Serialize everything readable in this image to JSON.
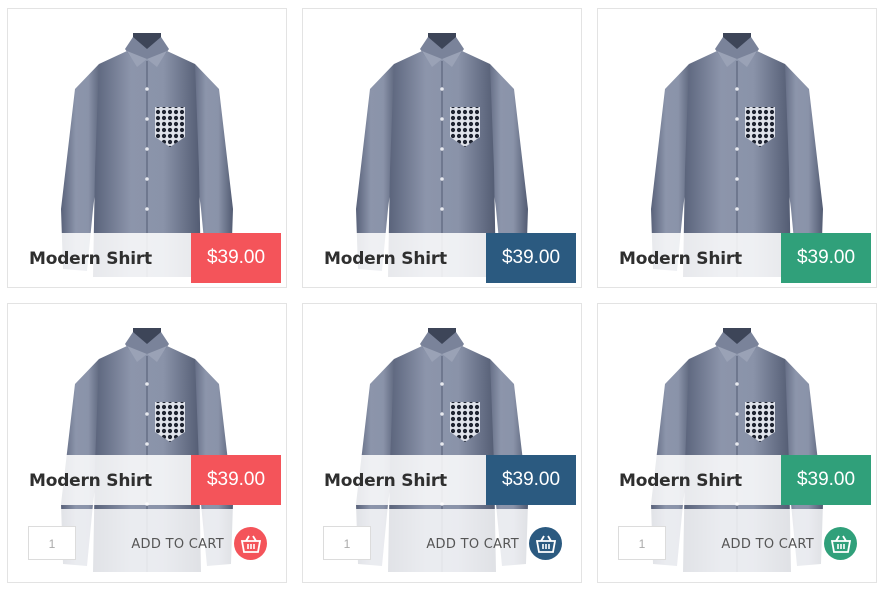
{
  "products": [
    {
      "name": "Modern Shirt",
      "price": "$39.00",
      "color": "#f4545a"
    },
    {
      "name": "Modern Shirt",
      "price": "$39.00",
      "color": "#2b5a80"
    },
    {
      "name": "Modern Shirt",
      "price": "$39.00",
      "color": "#30a07a"
    },
    {
      "name": "Modern Shirt",
      "price": "$39.00",
      "color": "#f4545a",
      "qty": "1",
      "add_to_cart": "ADD TO CART",
      "icon": "basket-icon"
    },
    {
      "name": "Modern Shirt",
      "price": "$39.00",
      "color": "#2b5a80",
      "qty": "1",
      "add_to_cart": "ADD TO CART",
      "icon": "basket-icon"
    },
    {
      "name": "Modern Shirt",
      "price": "$39.00",
      "color": "#30a07a",
      "qty": "1",
      "add_to_cart": "ADD TO CART",
      "icon": "basket-icon"
    }
  ]
}
